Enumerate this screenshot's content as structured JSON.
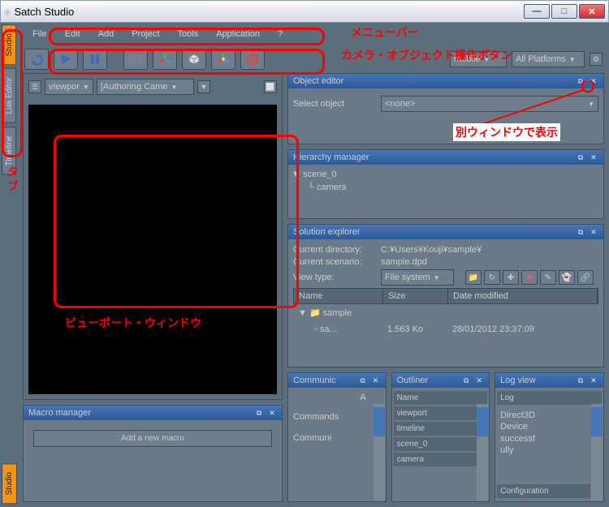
{
  "window": {
    "title": "Satch Studio"
  },
  "tabs": {
    "studio": "Studio",
    "lua": "Lua Editor",
    "timeline": "Timeline",
    "bottom": "Studio"
  },
  "menu": {
    "file": "File",
    "edit": "Edit",
    "add": "Add",
    "project": "Project",
    "tools": "Tools",
    "application": "Application",
    "help": "?"
  },
  "toolbar": {
    "platform": "All Platforms",
    "mobile": "mobile"
  },
  "viewport": {
    "combo1": "viewpor",
    "combo2": "[Authoring Came"
  },
  "object": {
    "title": "Object editor",
    "select_lbl": "Select object",
    "select_val": "<none>"
  },
  "hierarchy": {
    "title": "Hierarchy manager",
    "root": "scene_0",
    "child": "camera"
  },
  "solution": {
    "title": "Solution explorer",
    "dir_lbl": "Current directory:",
    "dir_val": "C:¥Users¥Kouji¥sample¥",
    "scen_lbl": "Current scenario:",
    "scen_val": "sample.dpd",
    "view_lbl": "View type:",
    "view_val": "File system",
    "col_name": "Name",
    "col_size": "Size",
    "col_date": "Date modified",
    "row1": "sample",
    "row2_name": "sa...",
    "row2_size": "1.563 Ko",
    "row2_date": "28/01/2012 23:37:09"
  },
  "macro": {
    "title": "Macro manager",
    "btn": "Add a new macro"
  },
  "comm": {
    "title": "Communic",
    "lbl1": "A",
    "lbl2": "Commands",
    "lbl3": "Communi"
  },
  "outliner": {
    "title": "Outliner",
    "col": "Name",
    "i1": "viewport",
    "i2": "timeline",
    "i3": "scene_0",
    "i4": "camera"
  },
  "log": {
    "title": "Log view",
    "col": "Log",
    "l1": "Direct3D",
    "l2": "Device",
    "l3": "successf",
    "l4": "ully",
    "cfg": "Configuration"
  },
  "annotations": {
    "menubar": "メニューバー",
    "camera": "カメラ・オブジェクト操作ボタン",
    "tab": "タブ",
    "viewport": "ビューポート・ウィンドウ",
    "separate": "別ウィンドウで表示"
  }
}
